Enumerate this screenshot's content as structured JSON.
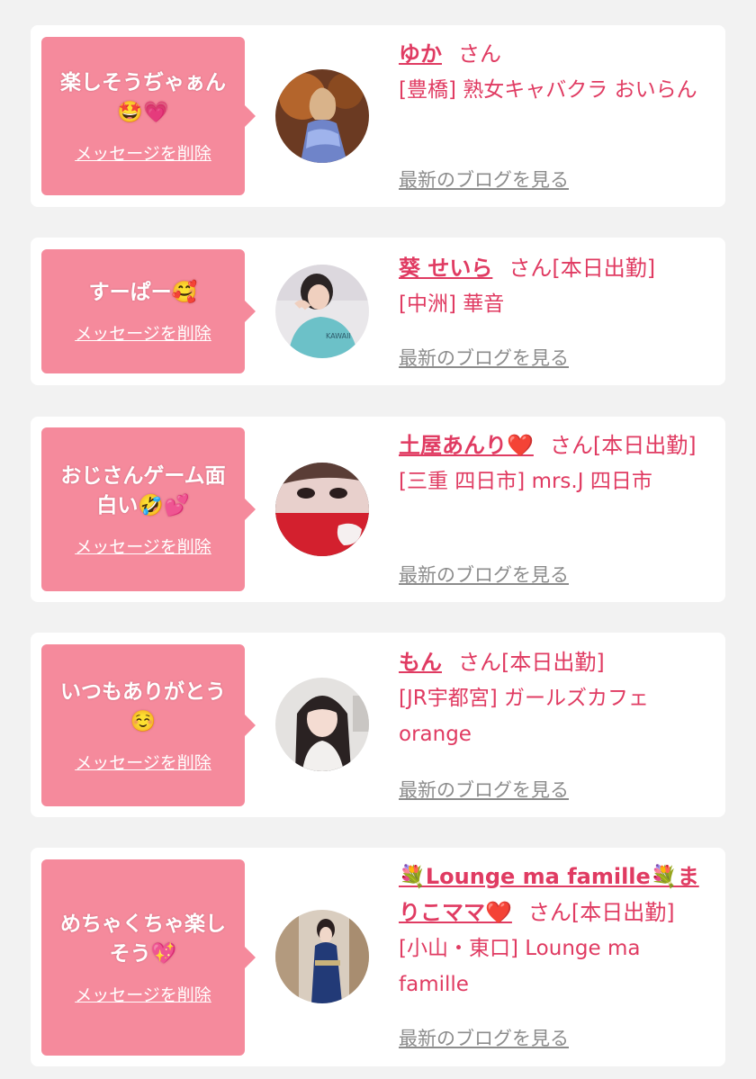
{
  "delete_label": "メッセージを削除",
  "blog_label": "最新のブログを見る",
  "san_label": "さん",
  "cards": [
    {
      "message": "楽しそうぢゃぁん🤩💗",
      "name": "ゆか",
      "duty": "",
      "shop": "[豊橋] 熟女キャバクラ おいらん"
    },
    {
      "message": "すーぱー🥰",
      "name": "葵 せいら",
      "duty": "[本日出勤]",
      "shop": "[中洲] 華音"
    },
    {
      "message": "おじさんゲーム面白い🤣💕",
      "name": "土屋あんり❤️",
      "duty": "[本日出勤]",
      "shop": "[三重 四日市] mrs.J 四日市"
    },
    {
      "message": "いつもありがとう☺️",
      "name": "もん",
      "duty": "[本日出勤]",
      "shop": "[JR宇都宮] ガールズカフェorange"
    },
    {
      "message": "めちゃくちゃ楽しそう💖",
      "name": "💐Lounge ma famille💐まりこママ❤️",
      "duty": "[本日出勤]",
      "shop": "[小山・東口] Lounge ma famille"
    }
  ],
  "colors": {
    "background": "#f2f2f2",
    "bubble": "#f58a9c",
    "accent": "#e03b62",
    "link_gray": "#8c8c8c"
  }
}
